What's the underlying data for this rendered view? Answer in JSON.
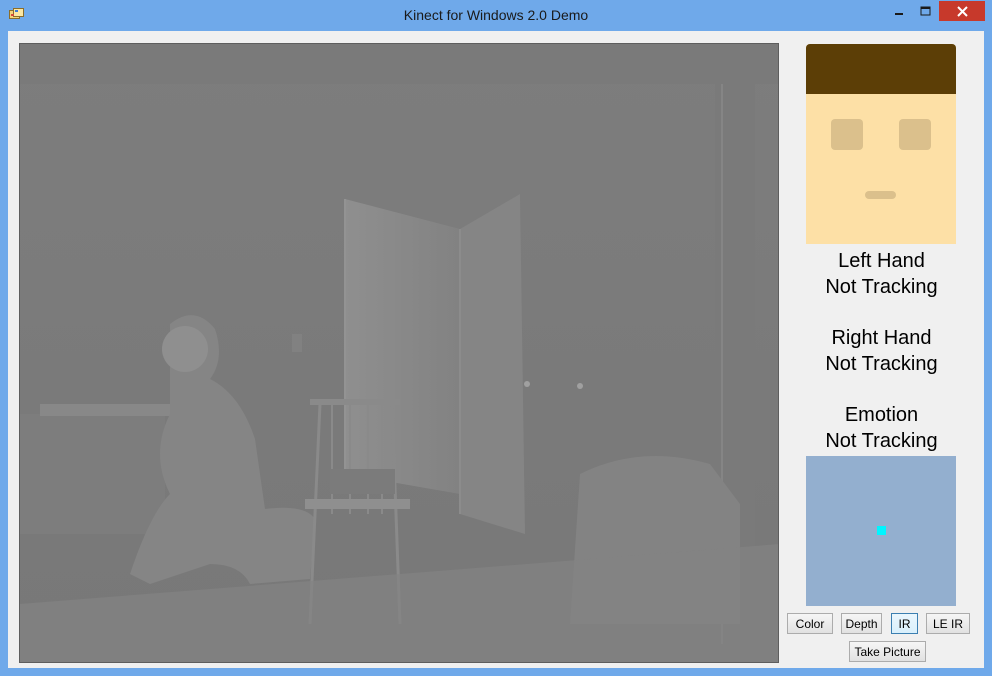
{
  "window": {
    "title": "Kinect for Windows 2.0 Demo"
  },
  "camera": {
    "mode": "IR"
  },
  "face": {
    "hair_color": "#5c3e06",
    "skin_color": "#fde0a6",
    "feature_color": "#dbc08c"
  },
  "status": {
    "left_hand_title": "Left Hand",
    "left_hand_state": "Not Tracking",
    "right_hand_title": "Right Hand",
    "right_hand_state": "Not Tracking",
    "emotion_title": "Emotion",
    "emotion_state": "Not Tracking"
  },
  "minimap": {
    "background": "#93afcf",
    "marker_color": "#00f5ff"
  },
  "buttons": {
    "color": "Color",
    "depth": "Depth",
    "ir": "IR",
    "le_ir": "LE IR",
    "take_picture": "Take Picture"
  }
}
